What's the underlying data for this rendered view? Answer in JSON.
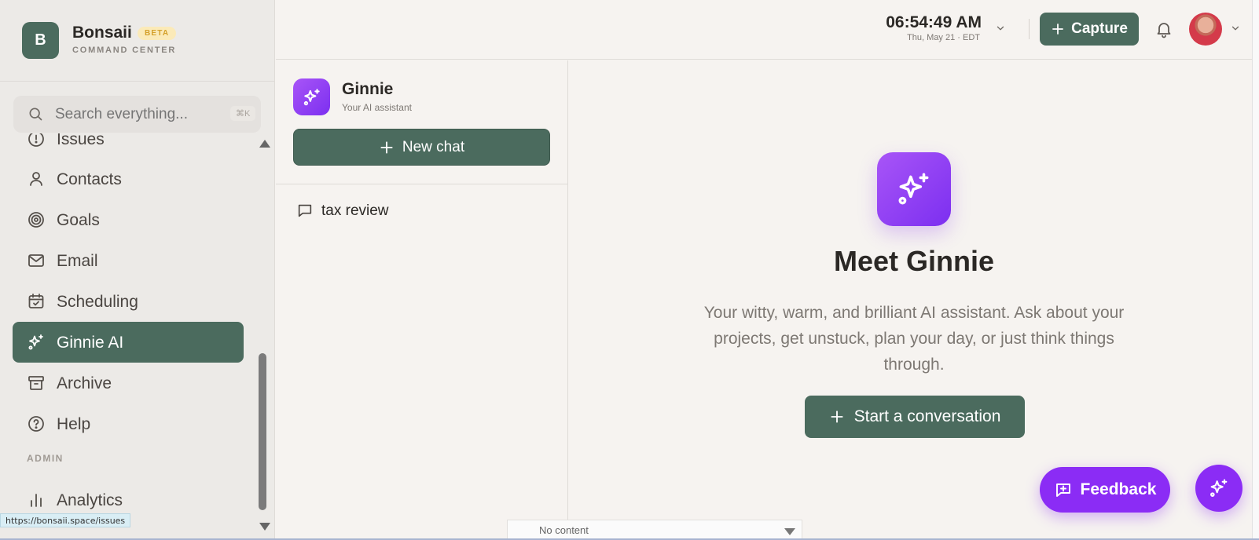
{
  "brand": {
    "logo_letter": "B",
    "name": "Bonsaii",
    "badge": "BETA",
    "subtitle": "COMMAND CENTER"
  },
  "search": {
    "placeholder": "Search everything...",
    "shortcut": "⌘K"
  },
  "sidebar": {
    "items": [
      {
        "label": "Issues",
        "icon": "alert-circle-icon"
      },
      {
        "label": "Contacts",
        "icon": "user-icon"
      },
      {
        "label": "Goals",
        "icon": "target-icon"
      },
      {
        "label": "Email",
        "icon": "mail-icon"
      },
      {
        "label": "Scheduling",
        "icon": "calendar-check-icon"
      },
      {
        "label": "Ginnie AI",
        "icon": "sparkles-icon",
        "active": true
      },
      {
        "label": "Archive",
        "icon": "archive-icon"
      },
      {
        "label": "Help",
        "icon": "help-circle-icon"
      }
    ],
    "admin_section": "ADMIN",
    "admin_items": [
      {
        "label": "Analytics",
        "icon": "bar-chart-icon"
      }
    ]
  },
  "status_url": "https://bonsaii.space/issues",
  "topbar": {
    "time": "06:54:49 AM",
    "date": "Thu, May 21 · EDT",
    "capture_label": "Capture"
  },
  "assistant": {
    "name": "Ginnie",
    "subtitle": "Your AI assistant",
    "new_chat_label": "New chat",
    "chats": [
      {
        "title": "tax review"
      }
    ]
  },
  "hero": {
    "title": "Meet Ginnie",
    "description": "Your witty, warm, and brilliant AI assistant. Ask about your projects, get unstuck, plan your day, or just think things through.",
    "cta_label": "Start a conversation"
  },
  "feedback_label": "Feedback",
  "autocomplete_empty": "No content",
  "colors": {
    "brand_green": "#4b6b5e",
    "ai_purple": "#8b2cf5",
    "beta_bg": "#fbeab8"
  }
}
